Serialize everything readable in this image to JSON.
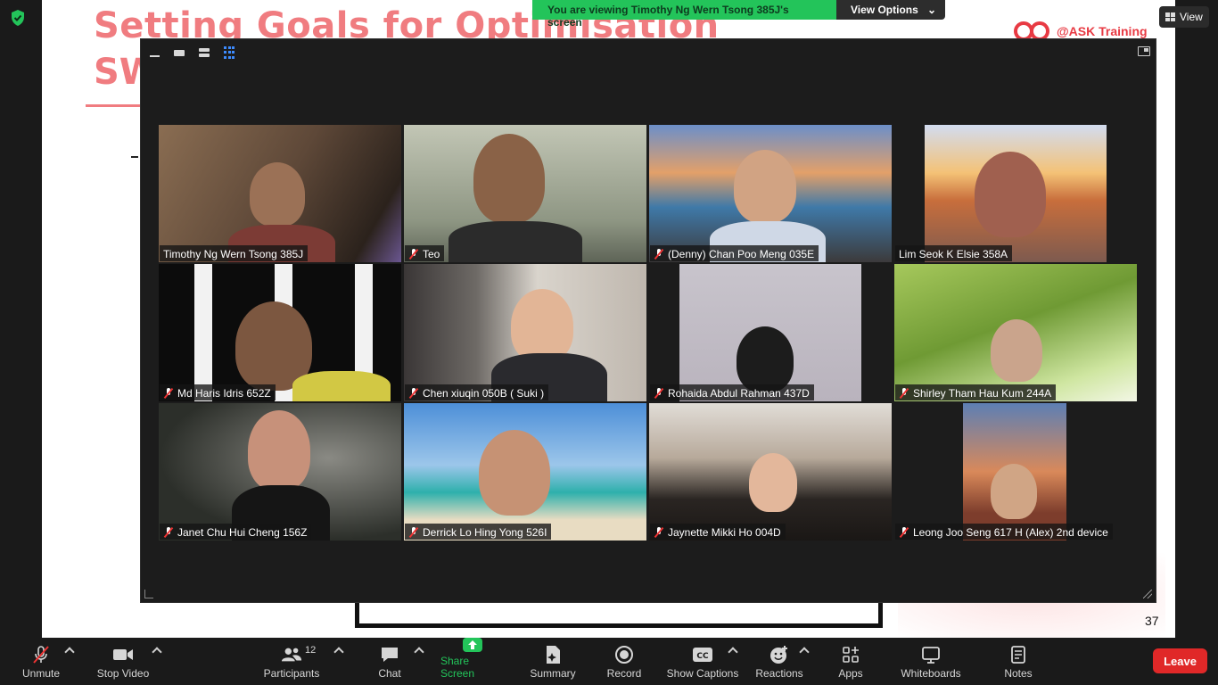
{
  "slide": {
    "title_line1": "Setting Goals for Optimisation",
    "title_line2": "SW",
    "brand": "@ASK Training",
    "page_number": "37"
  },
  "banner": {
    "message": "You are viewing Timothy Ng Wern Tsong 385J's screen",
    "view_options": "View Options"
  },
  "top_right": {
    "view_label": "View"
  },
  "participants": [
    {
      "name": "Timothy Ng Wern Tsong 385J",
      "muted": false,
      "active": true
    },
    {
      "name": "Teo",
      "muted": true,
      "active": false
    },
    {
      "name": "(Denny) Chan Poo Meng 035E",
      "muted": true,
      "active": false
    },
    {
      "name": "Lim Seok K Elsie 358A",
      "muted": false,
      "active": false
    },
    {
      "name": "Md Haris Idris 652Z",
      "muted": true,
      "active": false
    },
    {
      "name": "Chen xiuqin 050B ( Suki )",
      "muted": true,
      "active": false
    },
    {
      "name": "Rohaida Abdul Rahman 437D",
      "muted": true,
      "active": false
    },
    {
      "name": "Shirley Tham Hau Kum 244A",
      "muted": true,
      "active": false
    },
    {
      "name": "Janet Chu Hui Cheng 156Z",
      "muted": true,
      "active": false
    },
    {
      "name": "Derrick Lo Hing Yong 526I",
      "muted": true,
      "active": false
    },
    {
      "name": "Jaynette Mikki Ho 004D",
      "muted": true,
      "active": false
    },
    {
      "name": "Leong Joo Seng 617 H (Alex) 2nd device",
      "muted": true,
      "active": false
    }
  ],
  "toolbar": {
    "unmute": "Unmute",
    "stop_video": "Stop Video",
    "participants": "Participants",
    "participants_count": "12",
    "chat": "Chat",
    "share_screen": "Share Screen",
    "summary": "Summary",
    "record": "Record",
    "show_captions": "Show Captions",
    "reactions": "Reactions",
    "apps": "Apps",
    "whiteboards": "Whiteboards",
    "notes": "Notes",
    "leave": "Leave"
  },
  "colors": {
    "accent_green": "#23c45a",
    "leave_red": "#e02828",
    "active_speaker": "#b7d34a",
    "slide_title": "#f07c80"
  }
}
